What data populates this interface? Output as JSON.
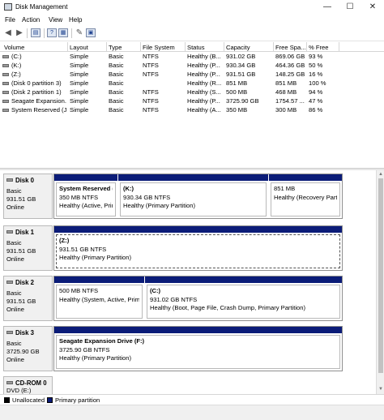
{
  "window": {
    "title": "Disk Management",
    "controls": {
      "minimize": "—",
      "maximize": "☐",
      "close": "✕"
    }
  },
  "menu": [
    "File",
    "Action",
    "View",
    "Help"
  ],
  "toolbar": {
    "back_icon": "back-arrow-icon",
    "forward_icon": "forward-arrow-icon"
  },
  "volume_table": {
    "headers": [
      "Volume",
      "Layout",
      "Type",
      "File System",
      "Status",
      "Capacity",
      "Free Spa...",
      "% Free"
    ],
    "rows": [
      [
        "(C:)",
        "Simple",
        "Basic",
        "NTFS",
        "Healthy (B...",
        "931.02 GB",
        "869.06 GB",
        "93 %"
      ],
      [
        "(K:)",
        "Simple",
        "Basic",
        "NTFS",
        "Healthy (P...",
        "930.34 GB",
        "464.36 GB",
        "50 %"
      ],
      [
        "(Z:)",
        "Simple",
        "Basic",
        "NTFS",
        "Healthy (P...",
        "931.51 GB",
        "148.25 GB",
        "16 %"
      ],
      [
        "(Disk 0 partition 3)",
        "Simple",
        "Basic",
        "",
        "Healthy (R...",
        "851 MB",
        "851 MB",
        "100 %"
      ],
      [
        "(Disk 2 partition 1)",
        "Simple",
        "Basic",
        "NTFS",
        "Healthy (S...",
        "500 MB",
        "468 MB",
        "94 %"
      ],
      [
        "Seagate Expansion...",
        "Simple",
        "Basic",
        "NTFS",
        "Healthy (P...",
        "3725.90 GB",
        "1754.57 ...",
        "47 %"
      ],
      [
        "System Reserved (J:)",
        "Simple",
        "Basic",
        "NTFS",
        "Healthy (A...",
        "350 MB",
        "300 MB",
        "86 %"
      ]
    ]
  },
  "disks": [
    {
      "name": "Disk 0",
      "type": "Basic",
      "size": "931.51 GB",
      "status": "Online",
      "partitions": [
        {
          "title": "System Reserved (",
          "size": "350 MB NTFS",
          "status": "Healthy (Active, Prim"
        },
        {
          "title": "(K:)",
          "size": "930.34 GB NTFS",
          "status": "Healthy (Primary Partition)"
        },
        {
          "title": "",
          "size": "851 MB",
          "status": "Healthy (Recovery Partitio"
        }
      ]
    },
    {
      "name": "Disk 1",
      "type": "Basic",
      "size": "931.51 GB",
      "status": "Online",
      "partitions": [
        {
          "title": "(Z:)",
          "size": "931.51 GB NTFS",
          "status": "Healthy (Primary Partition)"
        }
      ]
    },
    {
      "name": "Disk 2",
      "type": "Basic",
      "size": "931.51 GB",
      "status": "Online",
      "partitions": [
        {
          "title": "",
          "size": "500 MB NTFS",
          "status": "Healthy (System, Active, Prima"
        },
        {
          "title": "(C:)",
          "size": "931.02 GB NTFS",
          "status": "Healthy (Boot, Page File, Crash Dump, Primary Partition)"
        }
      ]
    },
    {
      "name": "Disk 3",
      "type": "Basic",
      "size": "3725.90 GB",
      "status": "Online",
      "partitions": [
        {
          "title": "Seagate Expansion Drive  (F:)",
          "size": "3725.90 GB NTFS",
          "status": "Healthy (Primary Partition)"
        }
      ]
    },
    {
      "name": "CD-ROM 0",
      "type": "DVD (E:)",
      "size": "",
      "status": "",
      "partitions": []
    }
  ],
  "legend": {
    "items": [
      {
        "label": "Unallocated",
        "color": "#000000"
      },
      {
        "label": "Primary partition",
        "color": "#0b1c78"
      }
    ]
  }
}
